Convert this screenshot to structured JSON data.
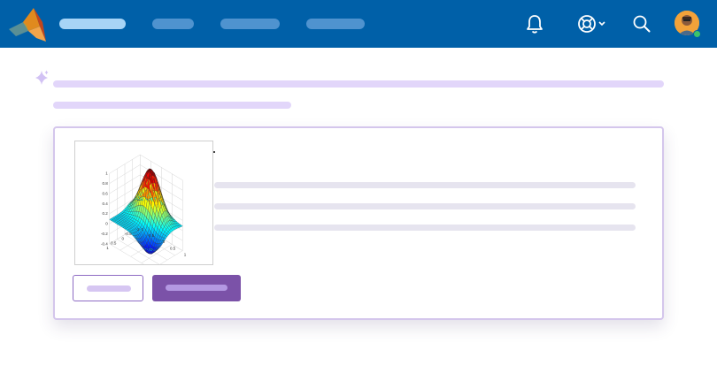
{
  "header": {
    "logo_icon": "matlab-membrane-logo",
    "nav_items": [
      "",
      "",
      "",
      ""
    ],
    "icons": [
      "bell-icon",
      "help-lifebuoy-icon",
      "chevron-down-icon",
      "search-icon"
    ],
    "avatar": "user-avatar",
    "presence_status": "online",
    "colors": {
      "bar": "#0060a8",
      "active_pill": "#a7d4f6",
      "pill": "#4f93cf",
      "presence": "#3cc46a"
    }
  },
  "ai_summary": {
    "icon": "sparkle-icon",
    "lines": [
      "",
      ""
    ],
    "color": "#e2d6fa"
  },
  "card": {
    "figure": {
      "type": "3d-surface-plot",
      "z_ticks": [
        "1",
        "0.8",
        "0.6",
        "0.4",
        "0.2",
        "0",
        "-0.2",
        "-0.4"
      ],
      "x_ticks": [
        "1",
        "0.5",
        "0",
        "-0.5",
        "-1"
      ],
      "y_ticks": [
        "-1",
        "-0.5",
        "0",
        "0.5",
        "1"
      ]
    },
    "text_lines": [
      "",
      "",
      ""
    ],
    "secondary_button_label": "",
    "primary_button_label": "",
    "colors": {
      "border": "#d4c6ec",
      "primary": "#7b52a8",
      "primary_pill": "#b398e2",
      "secondary_pill": "#d6c6f2"
    }
  }
}
